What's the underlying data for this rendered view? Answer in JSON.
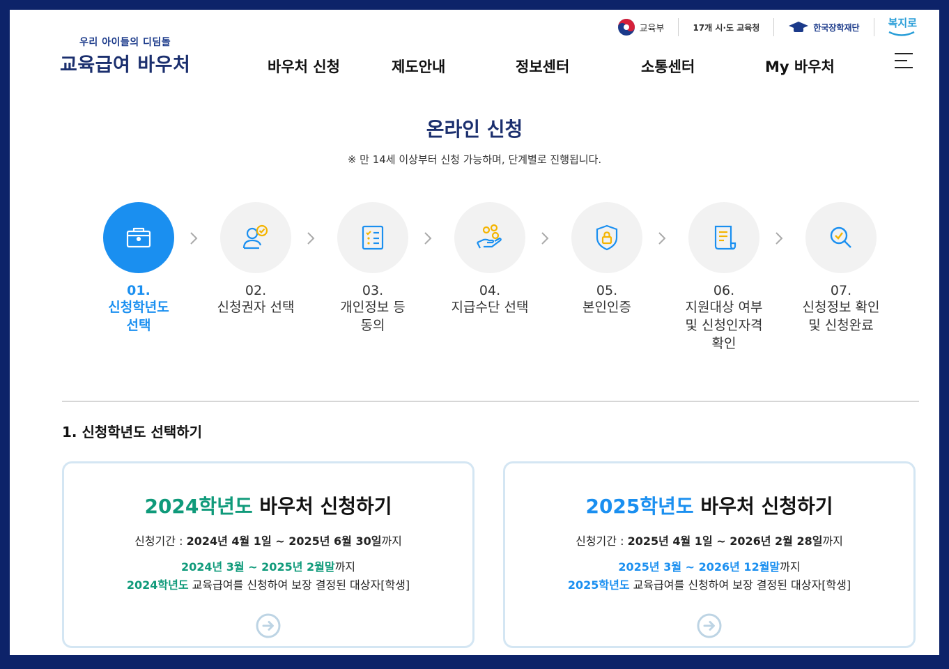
{
  "utility": {
    "moe": "교육부",
    "offices": "17개 시·도 교육청",
    "kosaf": "한국장학재단",
    "bokjiro": "복지로"
  },
  "logo": {
    "sub": "우리 아이들의 디딤돌",
    "main": "교육급여 바우처"
  },
  "nav": [
    "바우처 신청",
    "제도안내",
    "정보센터",
    "소통센터",
    "My 바우처"
  ],
  "page": {
    "title": "온라인 신청",
    "note": "※ 만 14세 이상부터 신청 가능하며, 단계별로 진행됩니다."
  },
  "steps": [
    {
      "num": "01.",
      "label": "신청학년도 선택",
      "icon": "folder-icon",
      "active": true
    },
    {
      "num": "02.",
      "label": "신청권자 선택",
      "icon": "user-check-icon",
      "active": false
    },
    {
      "num": "03.",
      "label": "개인정보 등 동의",
      "icon": "checklist-icon",
      "active": false
    },
    {
      "num": "04.",
      "label": "지급수단 선택",
      "icon": "hand-coin-icon",
      "active": false
    },
    {
      "num": "05.",
      "label": "본인인증",
      "icon": "shield-lock-icon",
      "active": false
    },
    {
      "num": "06.",
      "label": "지원대상 여부 및 신청인자격 확인",
      "icon": "document-icon",
      "active": false
    },
    {
      "num": "07.",
      "label": "신청정보 확인 및 신청완료",
      "icon": "magnifier-check-icon",
      "active": false
    }
  ],
  "section": {
    "title": "1. 신청학년도 선택하기"
  },
  "cards": [
    {
      "year": "2024학년도",
      "title_rest": " 바우처 신청하기",
      "period_label": "신청기간 : ",
      "period_value": "2024년 4월 1일 ~ 2025년 6월 30일",
      "period_suffix": "까지",
      "scope_range": "2024년 3월 ~ 2025년 2월말",
      "scope_range_suffix": "까지",
      "scope_year": "2024학년도",
      "scope_rest": " 교육급여를 신청하여 보장 결정된 대상자[학생]",
      "accent": "#0f9a7a"
    },
    {
      "year": "2025학년도",
      "title_rest": " 바우처 신청하기",
      "period_label": "신청기간 : ",
      "period_value": "2025년 4월 1일 ~ 2026년 2월 28일",
      "period_suffix": "까지",
      "scope_range": "2025년 3월 ~ 2026년 12월말",
      "scope_range_suffix": "까지",
      "scope_year": "2025학년도",
      "scope_rest": " 교육급여를 신청하여 보장 결정된 대상자[학생]",
      "accent": "#1a8ff0"
    }
  ],
  "colors": {
    "brand": "#1b2f6e",
    "active": "#1a8ff0",
    "accent_2024": "#0f9a7a",
    "accent_2025": "#1a8ff0"
  }
}
